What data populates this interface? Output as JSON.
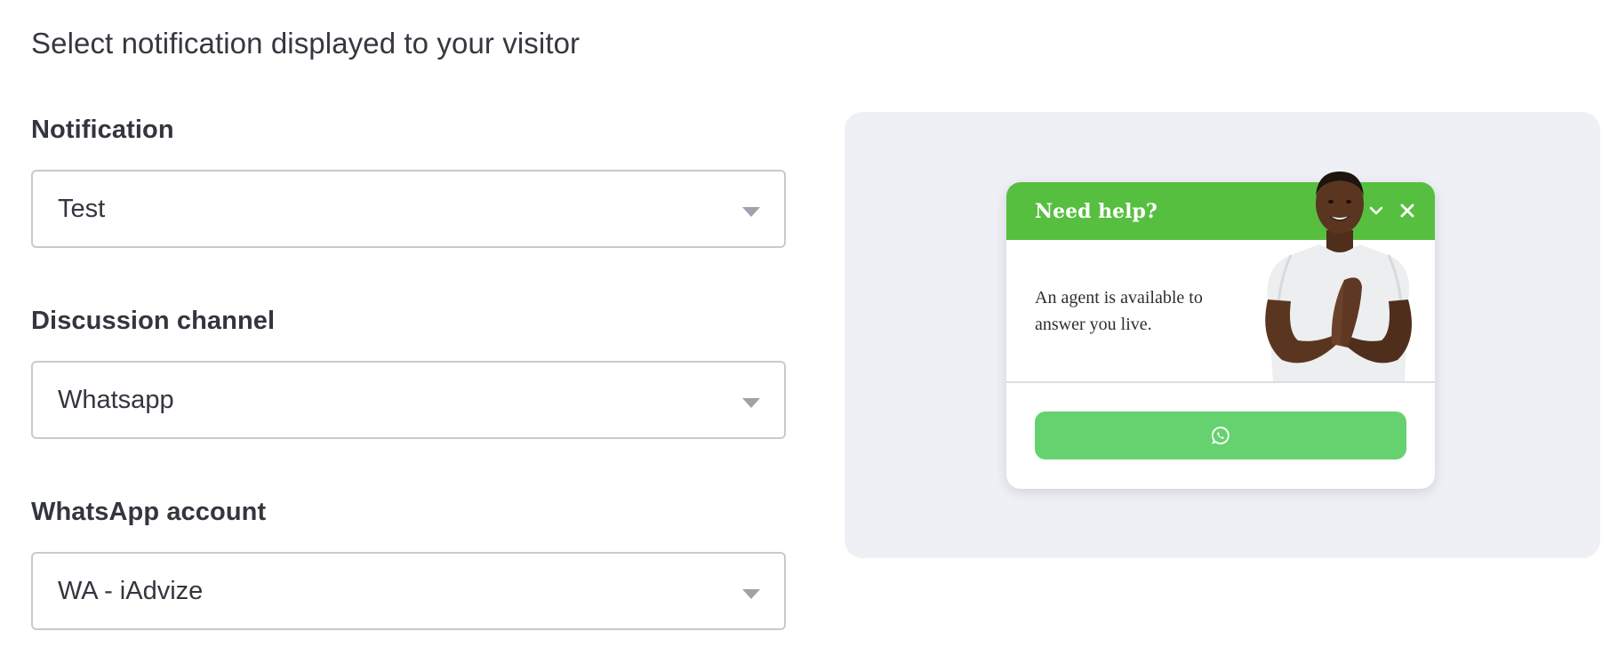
{
  "page": {
    "title": "Select notification displayed to your visitor"
  },
  "form": {
    "notification": {
      "label": "Notification",
      "value": "Test"
    },
    "channel": {
      "label": "Discussion channel",
      "value": "Whatsapp"
    },
    "account": {
      "label": "WhatsApp account",
      "value": "WA - iAdvize"
    }
  },
  "preview": {
    "widget": {
      "title": "Need help?",
      "message": "An agent is available to answer you live.",
      "header_icons": [
        "chevron-down-icon",
        "close-icon"
      ],
      "button_icon": "whatsapp-icon"
    },
    "colors": {
      "header": "#57bf40",
      "button": "#65d26f",
      "panel": "#eef0f5"
    }
  }
}
